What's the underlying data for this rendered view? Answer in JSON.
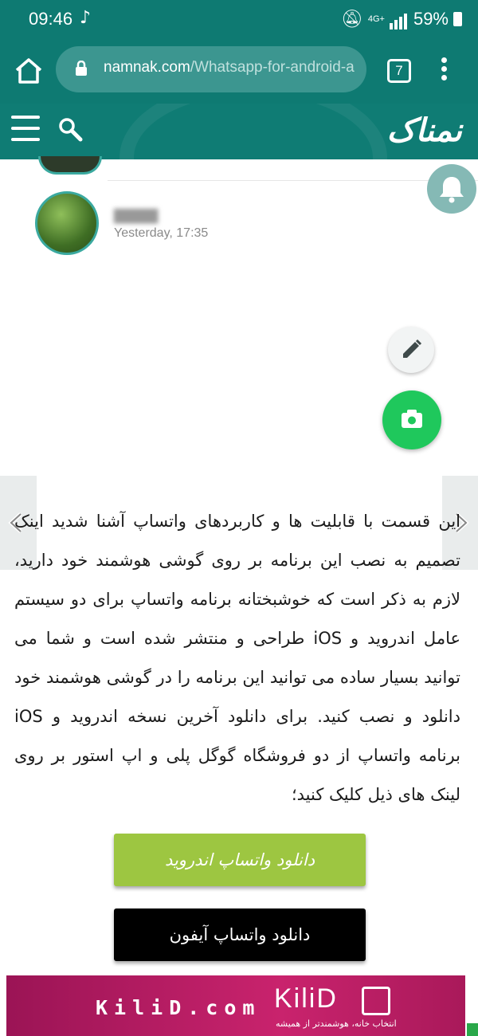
{
  "status_bar": {
    "time": "09:46",
    "network": "4G+",
    "battery": "59%"
  },
  "browser": {
    "url_domain": "namnak.com",
    "url_path": "/Whatsapp-for-android-a",
    "tab_count": "7"
  },
  "site": {
    "logo_text": "نمناک"
  },
  "chat_preview": {
    "contact_time": "Yesterday, 17:35"
  },
  "article": {
    "text": "این قسمت با قابلیت ها و کاربردهای واتساپ آشنا شدید اینک تصمیم به نصب این برنامه بر روی گوشی هوشمند خود دارید، لازم به ذکر است که خوشبختانه برنامه واتساپ برای دو سیستم عامل اندروید و iOS طراحی و منتشر شده است و شما می توانید بسیار ساده می توانید این برنامه را در گوشی هوشمند خود دانلود و نصب کنید. برای دانلود آخرین نسخه اندروید و iOS برنامه واتساپ از دو فروشگاه گوگل پلی و اپ استور بر روی لینک های ذیل کلیک کنید؛"
  },
  "buttons": {
    "android": "دانلود واتساپ اندروید",
    "iphone": "دانلود واتساپ آیفون"
  },
  "ad": {
    "brand": "KiliD.com",
    "logo": "KiliD",
    "tagline": "انتخاب خانه، هوشمندتر از همیشه"
  },
  "colors": {
    "header": "#0e7a72",
    "fab_green": "#1fc85c",
    "android_button": "#9dc641",
    "ad_bg": "#c9236d"
  }
}
